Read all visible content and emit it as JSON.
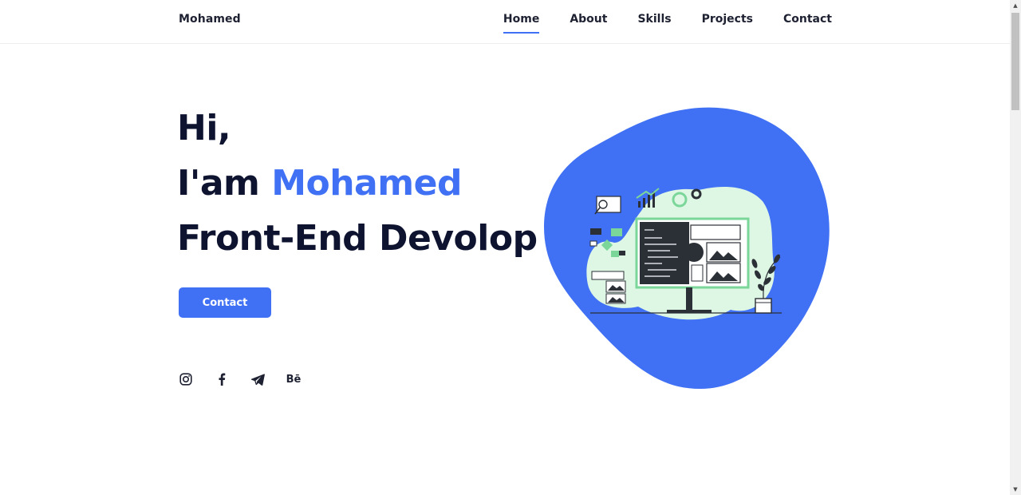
{
  "header": {
    "logo": "Mohamed",
    "nav": [
      {
        "label": "Home",
        "active": true
      },
      {
        "label": "About",
        "active": false
      },
      {
        "label": "Skills",
        "active": false
      },
      {
        "label": "Projects",
        "active": false
      },
      {
        "label": "Contact",
        "active": false
      }
    ]
  },
  "hero": {
    "greeting": "Hi,",
    "intro": "I'am",
    "name": "Mohamed",
    "role": "Front-End Devolop",
    "button_label": "Contact"
  },
  "socials": [
    {
      "icon": "instagram-icon"
    },
    {
      "icon": "facebook-icon"
    },
    {
      "icon": "telegram-icon"
    },
    {
      "icon": "behance-icon",
      "text": "Bē"
    }
  ],
  "colors": {
    "accent": "#4070f4",
    "text": "#0e1330",
    "illustration_green": "#7bd69a",
    "illustration_bg": "#def7e4"
  }
}
